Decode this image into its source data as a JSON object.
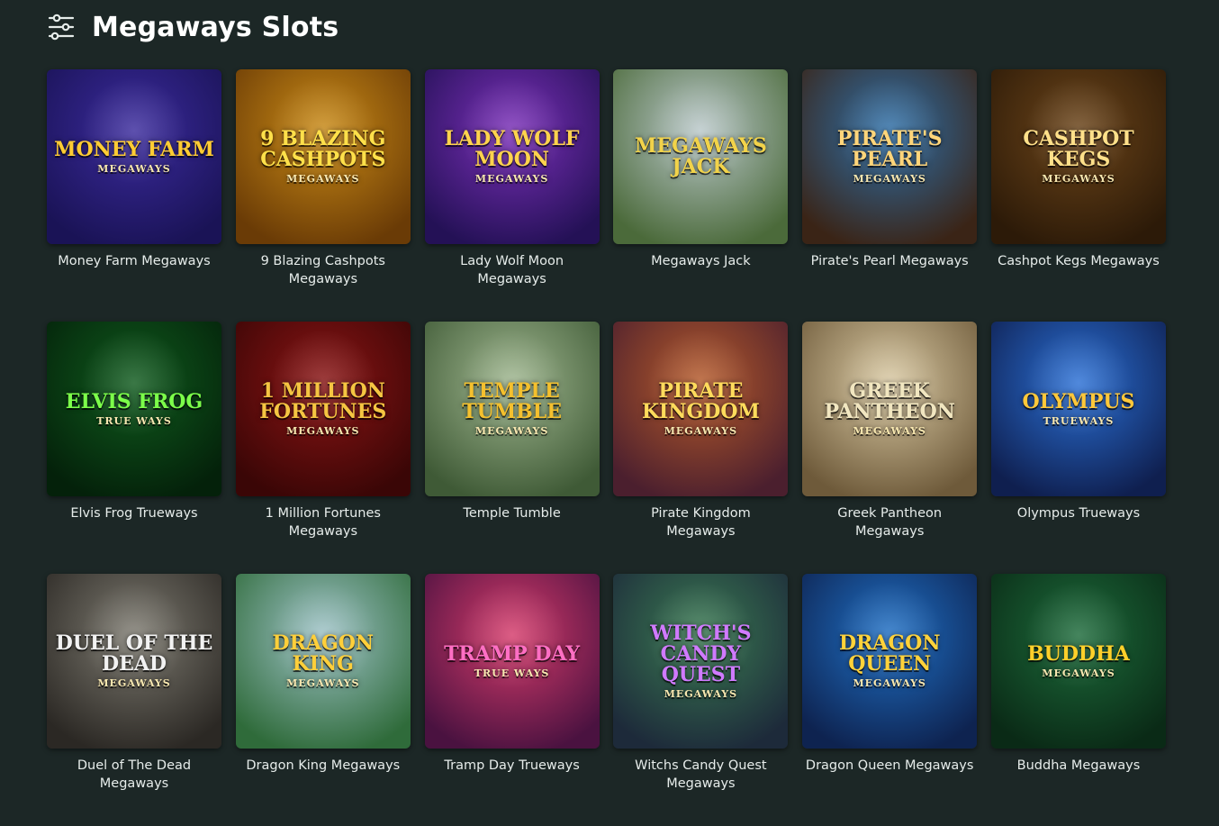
{
  "header": {
    "title": "Megaways Slots",
    "icon": "filter-icon"
  },
  "games": [
    {
      "title": "Money Farm Megaways",
      "logo": "Money Farm",
      "sub": "Megaways",
      "bg": [
        "#3a2a9c",
        "#1a1356"
      ],
      "accent": "#ffcc33"
    },
    {
      "title": "9 Blazing Cashpots Megaways",
      "logo": "9 Blazing Cashpots",
      "sub": "Megaways",
      "bg": [
        "#c98a16",
        "#6a3b06"
      ],
      "accent": "#ffe04a"
    },
    {
      "title": "Lady Wolf Moon Megaways",
      "logo": "Lady Wolf Moon",
      "sub": "Megaways",
      "bg": [
        "#7a2fb8",
        "#241156"
      ],
      "accent": "#ffd34d"
    },
    {
      "title": "Megaways Jack",
      "logo": "Megaways Jack",
      "sub": "",
      "bg": [
        "#b9c7c9",
        "#4b6a3a"
      ],
      "accent": "#f2d34a"
    },
    {
      "title": "Pirate's Pearl Megaways",
      "logo": "Pirate's Pearl",
      "sub": "Megaways",
      "bg": [
        "#2e6fa8",
        "#3a2416"
      ],
      "accent": "#ffd57a"
    },
    {
      "title": "Cashpot Kegs Megaways",
      "logo": "Cashpot Kegs",
      "sub": "Megaways",
      "bg": [
        "#6b4419",
        "#2c1a08"
      ],
      "accent": "#ffe08a"
    },
    {
      "title": "Elvis Frog Trueways",
      "logo": "Elvis Frog",
      "sub": "True Ways",
      "bg": [
        "#0f5a1d",
        "#04210a"
      ],
      "accent": "#7cff4a"
    },
    {
      "title": "1 Million Fortunes Megaways",
      "logo": "1 Million Fortunes",
      "sub": "Megaways",
      "bg": [
        "#8a1414",
        "#3a0606"
      ],
      "accent": "#f5c542"
    },
    {
      "title": "Temple Tumble",
      "logo": "Temple Tumble",
      "sub": "Megaways",
      "bg": [
        "#9fb68f",
        "#3f5a36"
      ],
      "accent": "#f4c02e"
    },
    {
      "title": "Pirate Kingdom Megaways",
      "logo": "Pirate Kingdom",
      "sub": "Megaways",
      "bg": [
        "#b55a2a",
        "#4b1f2e"
      ],
      "accent": "#ffdb5c"
    },
    {
      "title": "Greek Pantheon Megaways",
      "logo": "Greek Pantheon",
      "sub": "Megaways",
      "bg": [
        "#d9c9a3",
        "#6e5a3a"
      ],
      "accent": "#f1e6c0"
    },
    {
      "title": "Olympus Trueways",
      "logo": "Olympus",
      "sub": "Trueways",
      "bg": [
        "#2a6fd4",
        "#0f1f4f"
      ],
      "accent": "#ffc83a"
    },
    {
      "title": "Duel of The Dead Megaways",
      "logo": "Duel of the Dead",
      "sub": "Megaways",
      "bg": [
        "#7d7a70",
        "#2b2824"
      ],
      "accent": "#f2f2f2"
    },
    {
      "title": "Dragon King Megaways",
      "logo": "Dragon King",
      "sub": "Megaways",
      "bg": [
        "#9ec2c7",
        "#2f6b3a"
      ],
      "accent": "#ffcf3a"
    },
    {
      "title": "Tramp Day Trueways",
      "logo": "Tramp Day",
      "sub": "True Ways",
      "bg": [
        "#d43a6a",
        "#4a1240"
      ],
      "accent": "#ff6fc4"
    },
    {
      "title": "Witchs Candy Quest Megaways",
      "logo": "Witch's Candy Quest",
      "sub": "Megaways",
      "bg": [
        "#3a7a52",
        "#1d2a3a"
      ],
      "accent": "#d07aff"
    },
    {
      "title": "Dragon Queen Megaways",
      "logo": "Dragon Queen",
      "sub": "Megaways",
      "bg": [
        "#1f6fc4",
        "#0e2350"
      ],
      "accent": "#ffd23a"
    },
    {
      "title": "Buddha Megaways",
      "logo": "Buddha",
      "sub": "Megaways",
      "bg": [
        "#1c6a3a",
        "#0a2a16"
      ],
      "accent": "#ffd02a"
    }
  ]
}
